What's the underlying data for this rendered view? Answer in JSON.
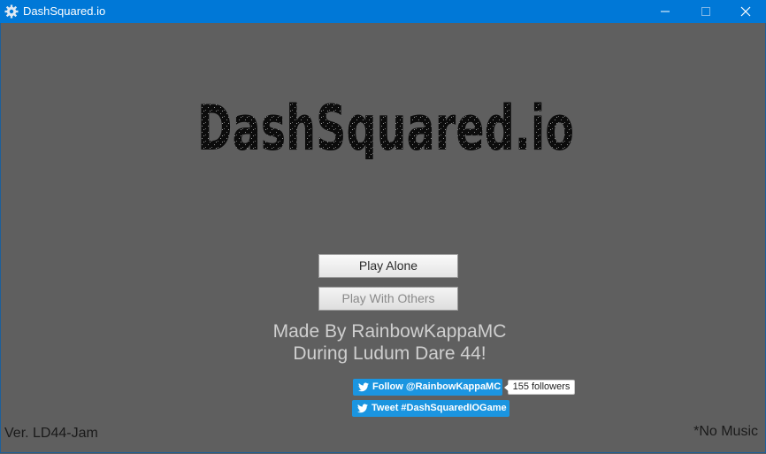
{
  "window": {
    "title": "DashSquared.io",
    "icon": "gear-icon",
    "controls": [
      "minimize-icon",
      "maximize-icon",
      "close-icon"
    ],
    "titlebar_color": "#0078d7"
  },
  "game": {
    "logo_text": "DashSquared.io",
    "buttons": {
      "play_alone": "Play Alone",
      "play_with_others": "Play With Others"
    },
    "credits": {
      "line1": "Made By RainbowKappaMC",
      "line2": "During Ludum Dare 44!"
    },
    "social": {
      "follow_label": "Follow @RainbowKappaMC",
      "followers": "155 followers",
      "tweet_label": "Tweet #DashSquaredIOGame",
      "icon": "twitter-bird-icon",
      "color": "#1b95e0"
    },
    "version": "Ver. LD44-Jam",
    "music_note": "*No Music"
  }
}
